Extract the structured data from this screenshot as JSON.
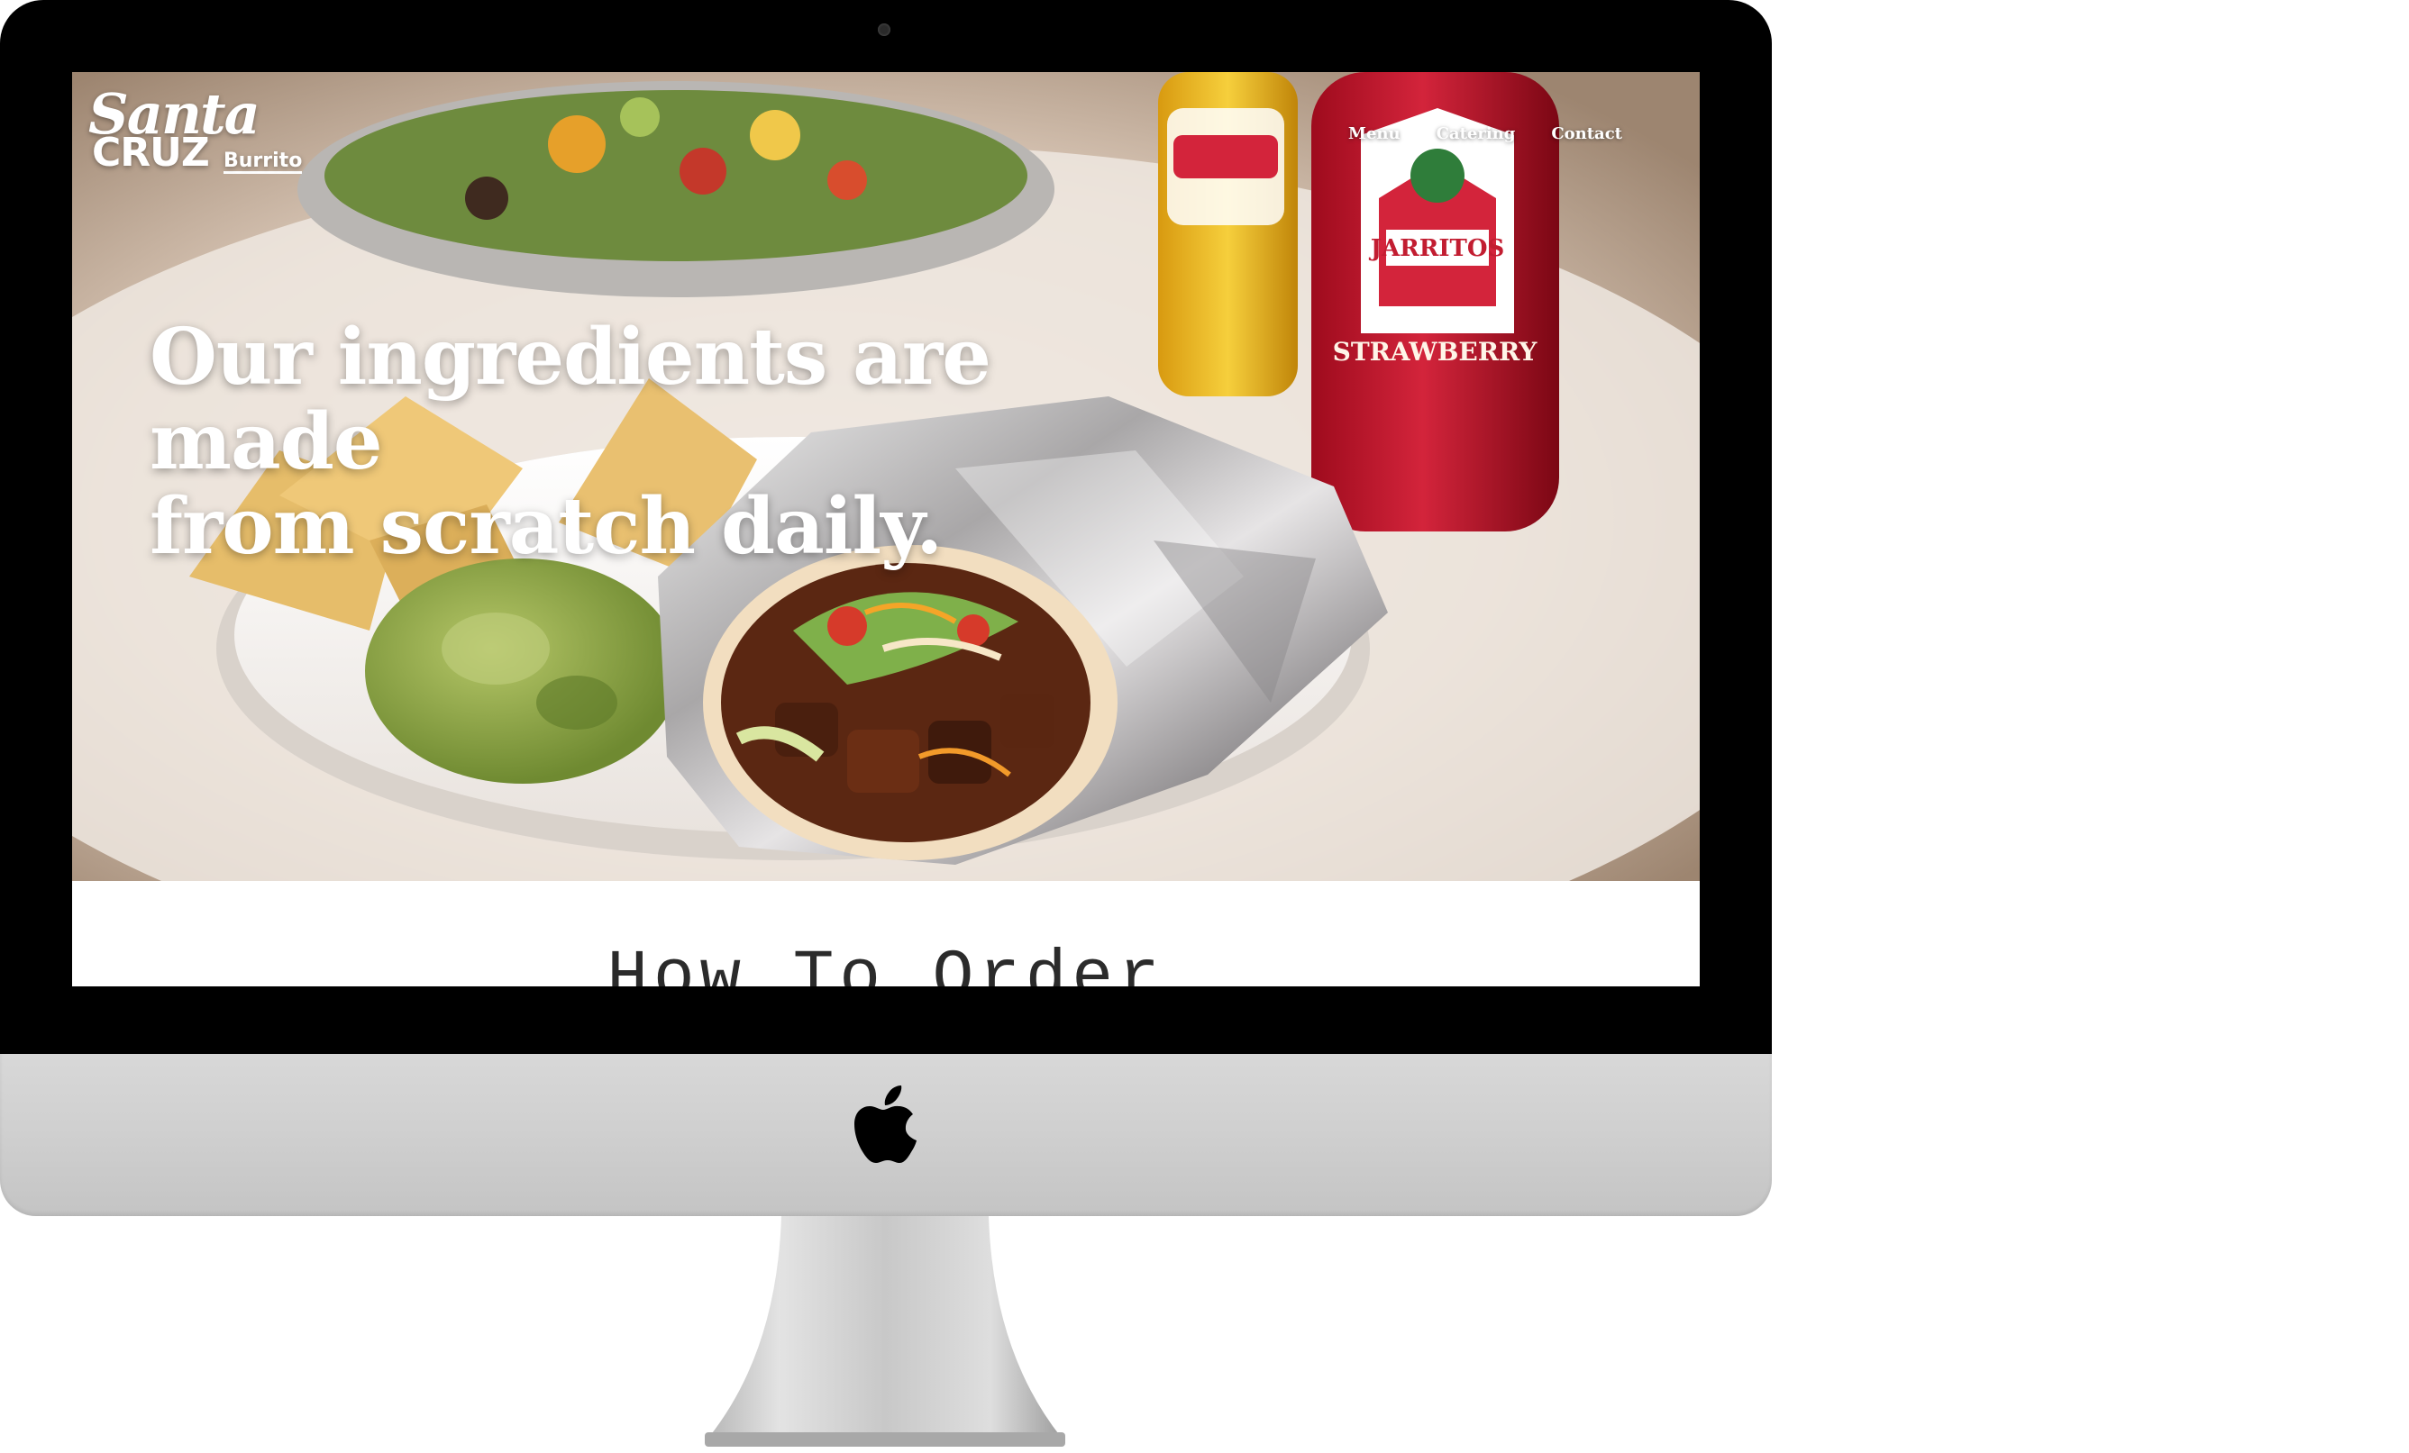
{
  "site": {
    "logo": {
      "line1": "Santa",
      "line2": "CRUZ",
      "line3": "Burrito"
    },
    "nav": {
      "items": [
        {
          "label": "Menu"
        },
        {
          "label": "Catering"
        },
        {
          "label": "Contact"
        }
      ]
    },
    "hero": {
      "headline_line1": "Our ingredients are made",
      "headline_line2": "from scratch daily."
    },
    "section": {
      "title": "How To Order"
    },
    "bottle_labels": {
      "jarritos": "JARRITOS",
      "flavor": "STRAWBERRY"
    }
  },
  "device": {
    "type": "iMac",
    "logo_icon": "apple-logo-icon",
    "bezel_color": "#000000",
    "chin_color": "#cfcfcf"
  },
  "colors": {
    "nav_text": "#ffffff",
    "headline_text": "#ffffff",
    "section_title": "#2b2b2b"
  }
}
